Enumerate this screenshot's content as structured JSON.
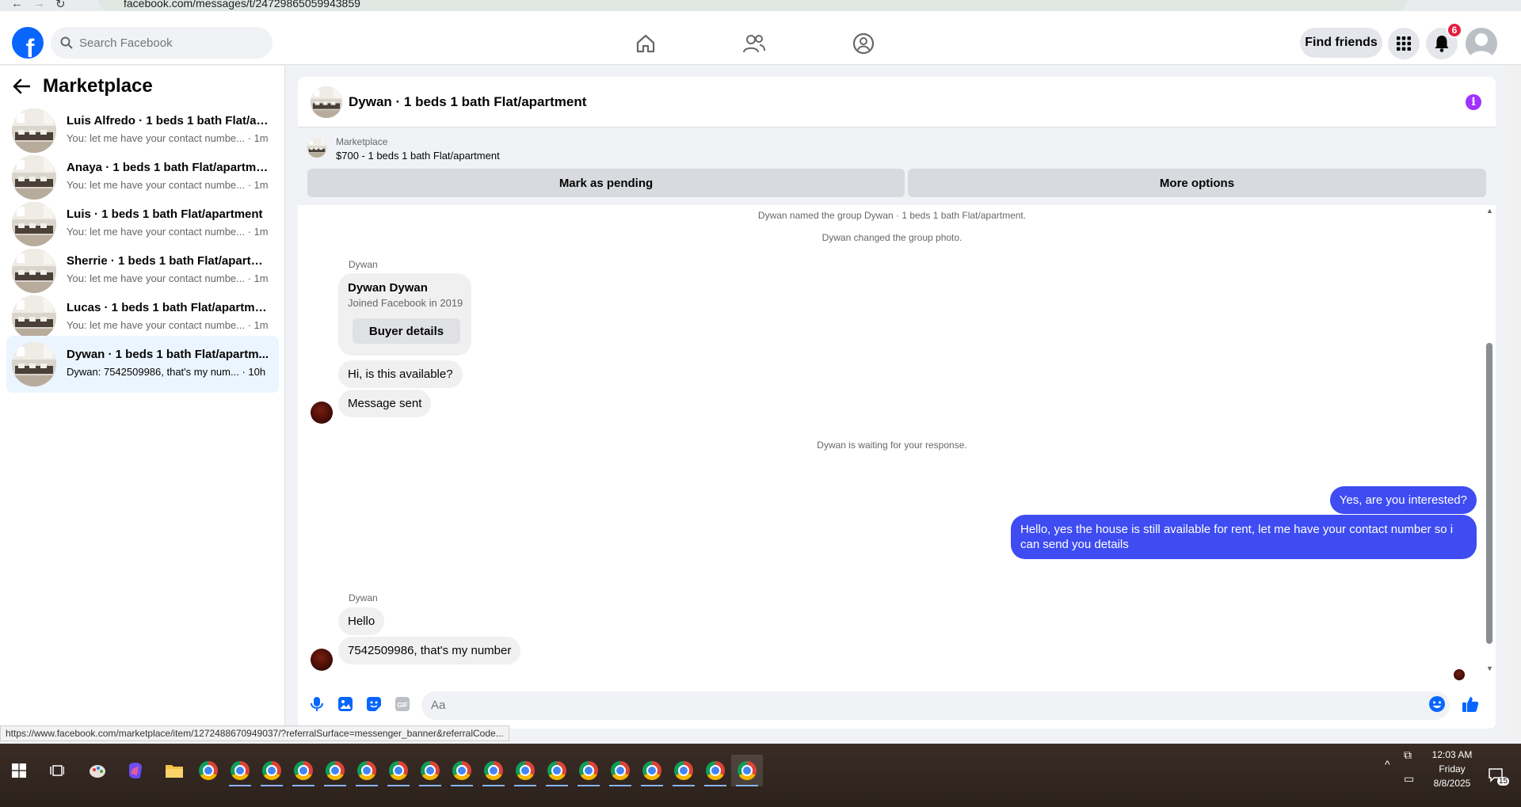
{
  "browser": {
    "url": "facebook.com/messages/t/24729865059943859"
  },
  "topnav": {
    "logo_letter": "f",
    "search_placeholder": "Search Facebook",
    "find_friends_label": "Find friends",
    "notification_count": "6"
  },
  "sidebar": {
    "title": "Marketplace",
    "conversations": [
      {
        "title": "Luis Alfredo · 1 beds 1 bath Flat/ap...",
        "preview": "You: let me have your contact numbe... · 1m"
      },
      {
        "title": "Anaya · 1 beds 1 bath Flat/apartme...",
        "preview": "You: let me have your contact numbe... · 1m"
      },
      {
        "title": "Luis · 1 beds 1 bath Flat/apartment",
        "preview": "You: let me have your contact numbe... · 1m"
      },
      {
        "title": "Sherrie · 1 beds 1 bath Flat/apartm...",
        "preview": "You: let me have your contact numbe... · 1m"
      },
      {
        "title": "Lucas · 1 beds 1 bath Flat/apartment",
        "preview": "You: let me have your contact numbe... · 1m"
      },
      {
        "title": "Dywan · 1 beds 1 bath Flat/apartm...",
        "preview": "Dywan: 7542509986, that's my num... · 10h"
      }
    ]
  },
  "chat": {
    "title": "Dywan · 1 beds 1 bath Flat/apartment",
    "listing": {
      "label": "Marketplace",
      "price_title": "$700 - 1 beds 1 bath Flat/apartment",
      "mark_pending_label": "Mark as pending",
      "more_options_label": "More options"
    },
    "system_messages": [
      "Dywan named the group Dywan · 1 beds 1 bath Flat/apartment.",
      "Dywan changed the group photo.",
      "Dywan is waiting for your response."
    ],
    "sender_name": "Dywan",
    "contact_card": {
      "name": "Dywan Dywan",
      "joined": "Joined Facebook in 2019",
      "button_label": "Buyer details"
    },
    "incoming_1": [
      "Hi, is this available?",
      "Message sent"
    ],
    "outgoing": [
      "Yes, are you interested?",
      "Hello, yes the house is still available for rent, let me have your contact number so i can send you details"
    ],
    "incoming_2": [
      "Hello",
      "7542509986, that's my number"
    ],
    "composer_placeholder": "Aa"
  },
  "status_link": "https://www.facebook.com/marketplace/item/1272488670949037/?referralSurface=messenger_banner&referralCode...",
  "taskbar": {
    "time": "12:03 AM",
    "day": "Friday",
    "date": "8/8/2025",
    "notification_count": "15"
  },
  "colors": {
    "brand": "#0866ff",
    "outgoing_bubble": "#3e4cf2",
    "info_icon": "#a033ff",
    "badge": "#e41e3f"
  }
}
